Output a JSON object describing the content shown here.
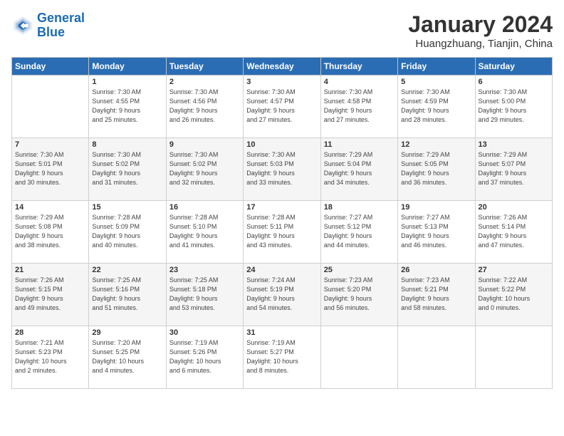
{
  "header": {
    "logo_line1": "General",
    "logo_line2": "Blue",
    "month_title": "January 2024",
    "location": "Huangzhuang, Tianjin, China"
  },
  "days_of_week": [
    "Sunday",
    "Monday",
    "Tuesday",
    "Wednesday",
    "Thursday",
    "Friday",
    "Saturday"
  ],
  "weeks": [
    [
      {
        "day": "",
        "info": ""
      },
      {
        "day": "1",
        "info": "Sunrise: 7:30 AM\nSunset: 4:55 PM\nDaylight: 9 hours\nand 25 minutes."
      },
      {
        "day": "2",
        "info": "Sunrise: 7:30 AM\nSunset: 4:56 PM\nDaylight: 9 hours\nand 26 minutes."
      },
      {
        "day": "3",
        "info": "Sunrise: 7:30 AM\nSunset: 4:57 PM\nDaylight: 9 hours\nand 27 minutes."
      },
      {
        "day": "4",
        "info": "Sunrise: 7:30 AM\nSunset: 4:58 PM\nDaylight: 9 hours\nand 27 minutes."
      },
      {
        "day": "5",
        "info": "Sunrise: 7:30 AM\nSunset: 4:59 PM\nDaylight: 9 hours\nand 28 minutes."
      },
      {
        "day": "6",
        "info": "Sunrise: 7:30 AM\nSunset: 5:00 PM\nDaylight: 9 hours\nand 29 minutes."
      }
    ],
    [
      {
        "day": "7",
        "info": "Sunrise: 7:30 AM\nSunset: 5:01 PM\nDaylight: 9 hours\nand 30 minutes."
      },
      {
        "day": "8",
        "info": "Sunrise: 7:30 AM\nSunset: 5:02 PM\nDaylight: 9 hours\nand 31 minutes."
      },
      {
        "day": "9",
        "info": "Sunrise: 7:30 AM\nSunset: 5:02 PM\nDaylight: 9 hours\nand 32 minutes."
      },
      {
        "day": "10",
        "info": "Sunrise: 7:30 AM\nSunset: 5:03 PM\nDaylight: 9 hours\nand 33 minutes."
      },
      {
        "day": "11",
        "info": "Sunrise: 7:29 AM\nSunset: 5:04 PM\nDaylight: 9 hours\nand 34 minutes."
      },
      {
        "day": "12",
        "info": "Sunrise: 7:29 AM\nSunset: 5:05 PM\nDaylight: 9 hours\nand 36 minutes."
      },
      {
        "day": "13",
        "info": "Sunrise: 7:29 AM\nSunset: 5:07 PM\nDaylight: 9 hours\nand 37 minutes."
      }
    ],
    [
      {
        "day": "14",
        "info": "Sunrise: 7:29 AM\nSunset: 5:08 PM\nDaylight: 9 hours\nand 38 minutes."
      },
      {
        "day": "15",
        "info": "Sunrise: 7:28 AM\nSunset: 5:09 PM\nDaylight: 9 hours\nand 40 minutes."
      },
      {
        "day": "16",
        "info": "Sunrise: 7:28 AM\nSunset: 5:10 PM\nDaylight: 9 hours\nand 41 minutes."
      },
      {
        "day": "17",
        "info": "Sunrise: 7:28 AM\nSunset: 5:11 PM\nDaylight: 9 hours\nand 43 minutes."
      },
      {
        "day": "18",
        "info": "Sunrise: 7:27 AM\nSunset: 5:12 PM\nDaylight: 9 hours\nand 44 minutes."
      },
      {
        "day": "19",
        "info": "Sunrise: 7:27 AM\nSunset: 5:13 PM\nDaylight: 9 hours\nand 46 minutes."
      },
      {
        "day": "20",
        "info": "Sunrise: 7:26 AM\nSunset: 5:14 PM\nDaylight: 9 hours\nand 47 minutes."
      }
    ],
    [
      {
        "day": "21",
        "info": "Sunrise: 7:26 AM\nSunset: 5:15 PM\nDaylight: 9 hours\nand 49 minutes."
      },
      {
        "day": "22",
        "info": "Sunrise: 7:25 AM\nSunset: 5:16 PM\nDaylight: 9 hours\nand 51 minutes."
      },
      {
        "day": "23",
        "info": "Sunrise: 7:25 AM\nSunset: 5:18 PM\nDaylight: 9 hours\nand 53 minutes."
      },
      {
        "day": "24",
        "info": "Sunrise: 7:24 AM\nSunset: 5:19 PM\nDaylight: 9 hours\nand 54 minutes."
      },
      {
        "day": "25",
        "info": "Sunrise: 7:23 AM\nSunset: 5:20 PM\nDaylight: 9 hours\nand 56 minutes."
      },
      {
        "day": "26",
        "info": "Sunrise: 7:23 AM\nSunset: 5:21 PM\nDaylight: 9 hours\nand 58 minutes."
      },
      {
        "day": "27",
        "info": "Sunrise: 7:22 AM\nSunset: 5:22 PM\nDaylight: 10 hours\nand 0 minutes."
      }
    ],
    [
      {
        "day": "28",
        "info": "Sunrise: 7:21 AM\nSunset: 5:23 PM\nDaylight: 10 hours\nand 2 minutes."
      },
      {
        "day": "29",
        "info": "Sunrise: 7:20 AM\nSunset: 5:25 PM\nDaylight: 10 hours\nand 4 minutes."
      },
      {
        "day": "30",
        "info": "Sunrise: 7:19 AM\nSunset: 5:26 PM\nDaylight: 10 hours\nand 6 minutes."
      },
      {
        "day": "31",
        "info": "Sunrise: 7:19 AM\nSunset: 5:27 PM\nDaylight: 10 hours\nand 8 minutes."
      },
      {
        "day": "",
        "info": ""
      },
      {
        "day": "",
        "info": ""
      },
      {
        "day": "",
        "info": ""
      }
    ]
  ]
}
